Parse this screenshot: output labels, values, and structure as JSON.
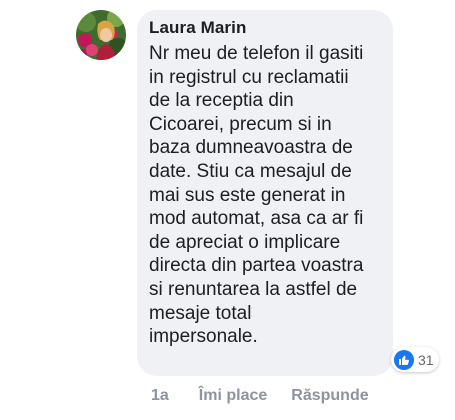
{
  "comment": {
    "author": "Laura Marin",
    "text": "Nr meu de telefon il gasiti\nin registrul cu reclamatii\nde la receptia din\nCicoarei, precum si in\nbaza dumneavoastra de\ndate. Stiu ca mesajul de\nmai sus este generat in\nmod automat, asa ca ar fi\nde apreciat o implicare\ndirecta din partea voastra\nsi renuntarea la astfel de\nmesaje total\nimpersonale.",
    "reactions": {
      "count": "31",
      "icon": "thumbs-up-icon",
      "color": "#1877f2"
    },
    "actions": {
      "timestamp": "1a",
      "like_label": "Îmi place",
      "reply_label": "Răspunde"
    }
  },
  "colors": {
    "bubble_bg": "#eff1f4",
    "text": "#1c1e21",
    "secondary": "#8d949e",
    "accent": "#1877f2"
  }
}
